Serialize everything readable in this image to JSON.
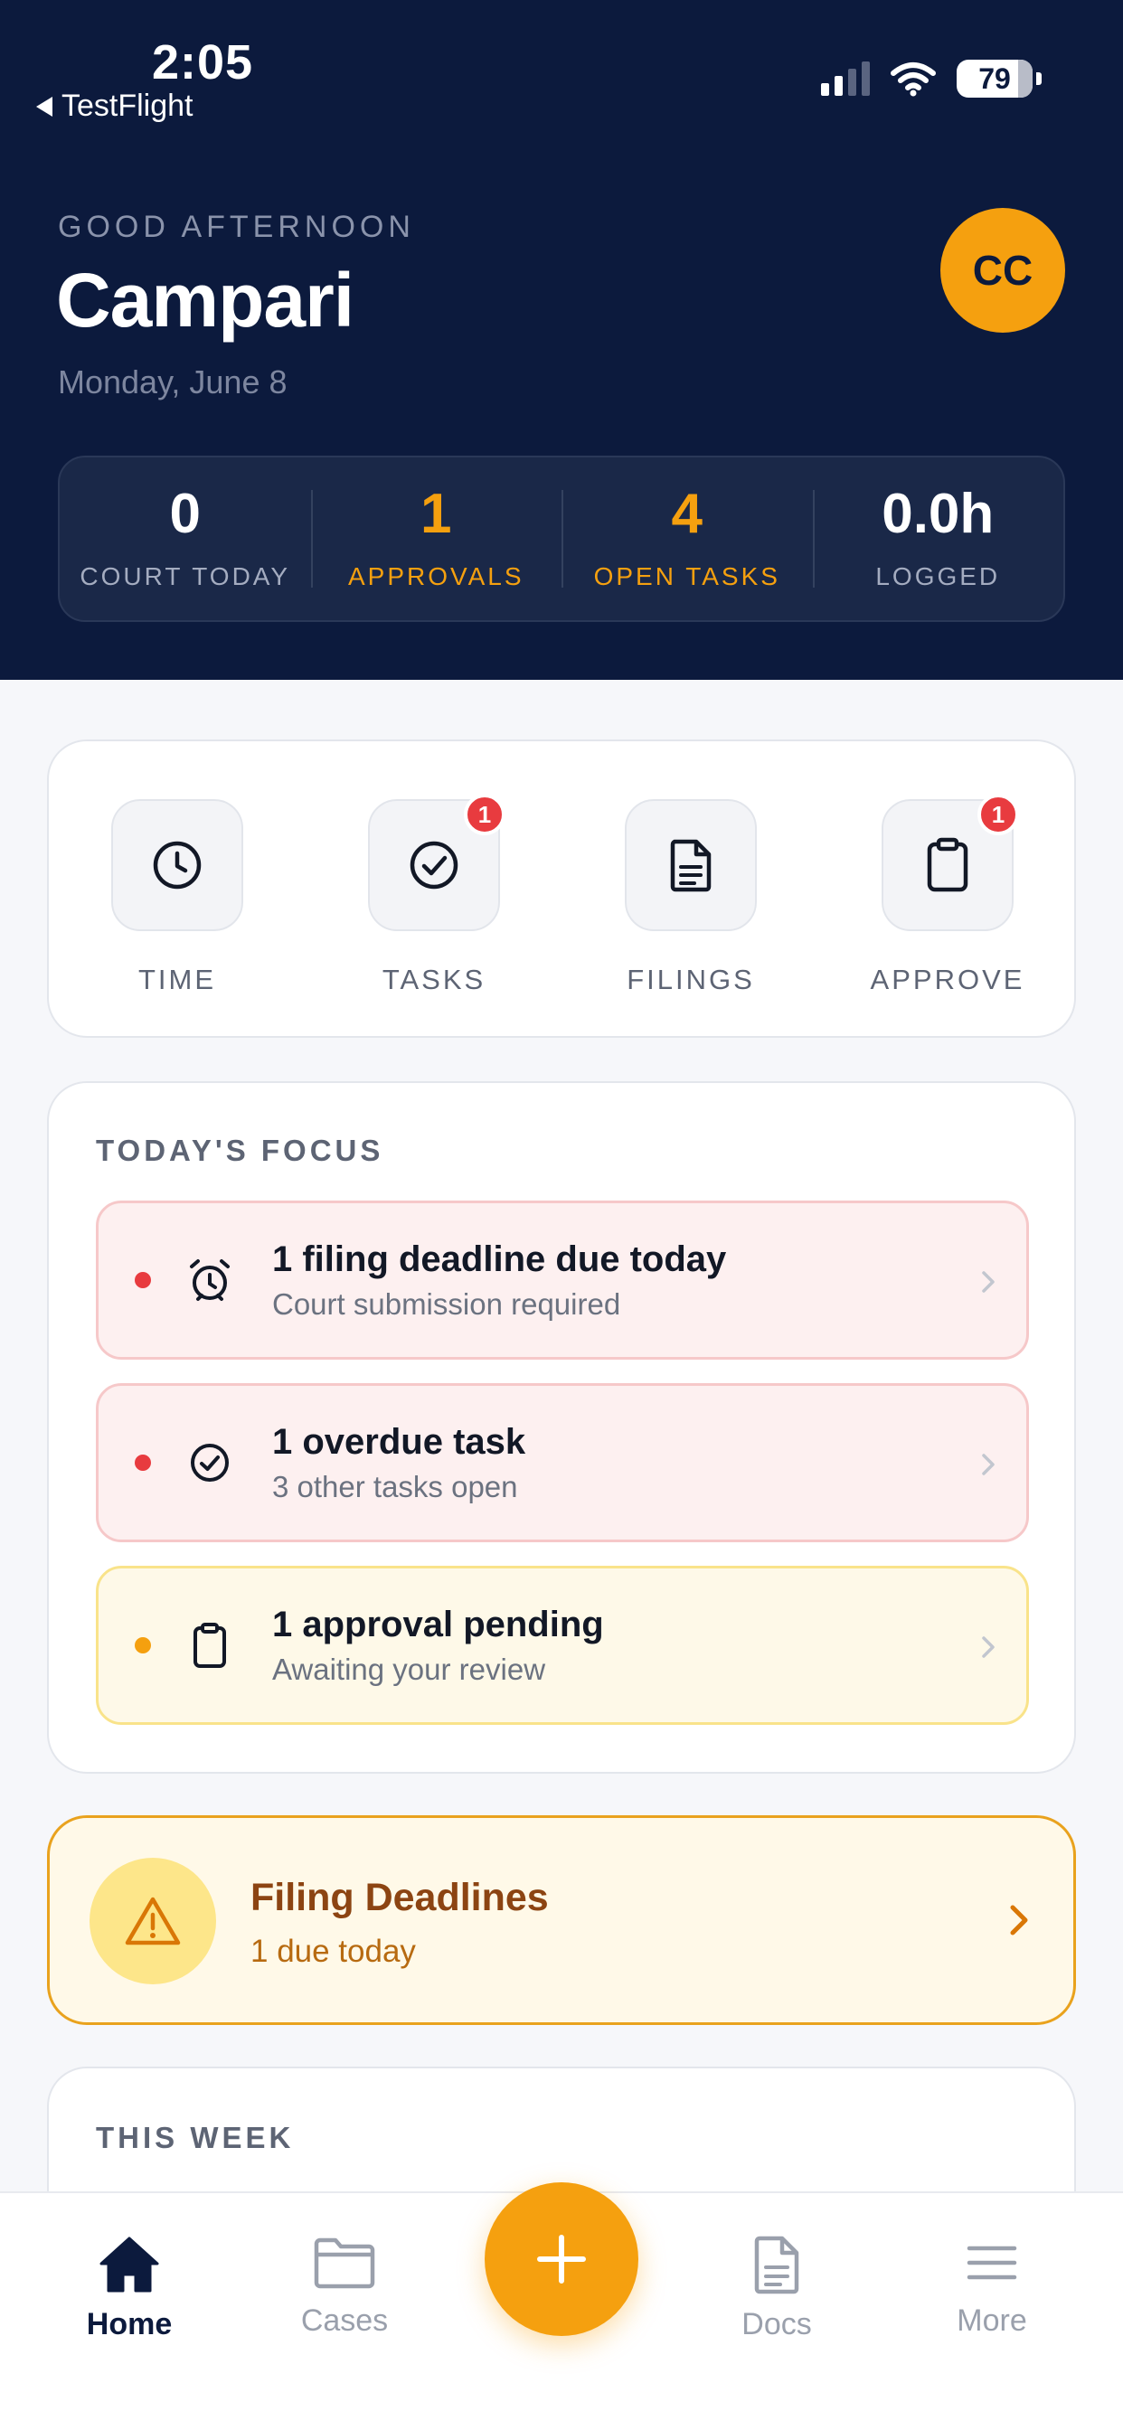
{
  "status_bar": {
    "time": "2:05",
    "back_app": "TestFlight",
    "battery": "79"
  },
  "header": {
    "greeting": "GOOD AFTERNOON",
    "name": "Campari",
    "date": "Monday, June 8",
    "avatar_initials": "CC"
  },
  "stats": [
    {
      "value": "0",
      "label": "COURT TODAY",
      "color": "#ffffff"
    },
    {
      "value": "1",
      "label": "APPROVALS",
      "color": "#f5a00f"
    },
    {
      "value": "4",
      "label": "OPEN TASKS",
      "color": "#f5a00f"
    },
    {
      "value": "0.0h",
      "label": "LOGGED",
      "color": "#ffffff"
    }
  ],
  "quick_actions": [
    {
      "label": "TIME",
      "icon": "clock-icon",
      "badge": null
    },
    {
      "label": "TASKS",
      "icon": "check-circle-icon",
      "badge": "1"
    },
    {
      "label": "FILINGS",
      "icon": "document-icon",
      "badge": null
    },
    {
      "label": "APPROVE",
      "icon": "clipboard-icon",
      "badge": "1"
    }
  ],
  "focus": {
    "title": "TODAY'S FOCUS",
    "items": [
      {
        "title": "1 filing deadline due today",
        "subtitle": "Court submission required",
        "icon": "alarm-clock-icon",
        "tone": "red"
      },
      {
        "title": "1 overdue task",
        "subtitle": "3 other tasks open",
        "icon": "check-circle-icon",
        "tone": "red"
      },
      {
        "title": "1 approval pending",
        "subtitle": "Awaiting your review",
        "icon": "clipboard-icon",
        "tone": "amber"
      }
    ]
  },
  "deadlines_banner": {
    "title": "Filing Deadlines",
    "subtitle": "1 due today",
    "icon": "warning-icon"
  },
  "week": {
    "title": "THIS WEEK"
  },
  "tabbar": {
    "tabs": [
      {
        "label": "Home",
        "icon": "home-icon",
        "active": true
      },
      {
        "label": "Cases",
        "icon": "folder-icon",
        "active": false
      },
      {
        "label": "Docs",
        "icon": "document-icon",
        "active": false
      },
      {
        "label": "More",
        "icon": "menu-icon",
        "active": false
      }
    ],
    "fab_icon": "plus-icon"
  },
  "colors": {
    "navy": "#0c1a3d",
    "accent": "#f5a00f",
    "danger": "#e83b3f"
  }
}
